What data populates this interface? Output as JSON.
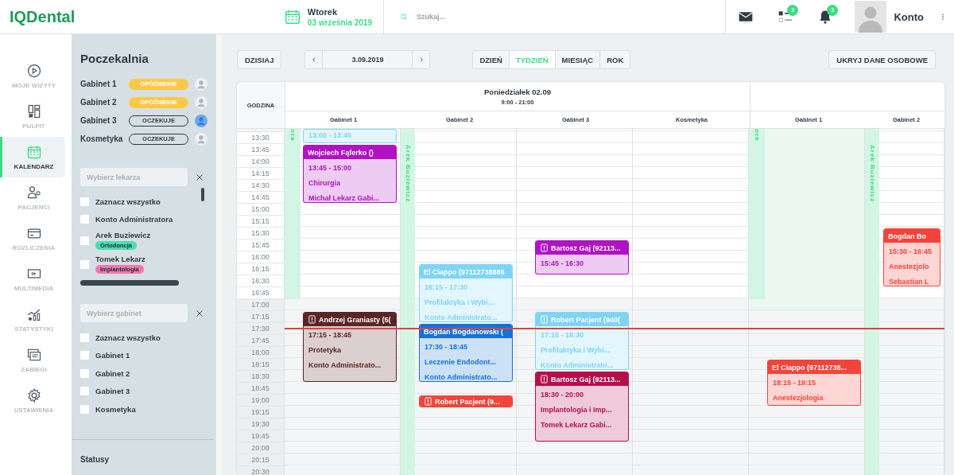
{
  "topbar": {
    "logo": "IQDental",
    "day": "Wtorek",
    "date": "03 września 2019",
    "search": {
      "placeholder": "Szukaj..."
    },
    "actions": [
      {
        "kind": "mail"
      },
      {
        "kind": "tasks",
        "badge": "2"
      },
      {
        "kind": "bell",
        "badge": "2"
      }
    ],
    "account": "Konto"
  },
  "nav": [
    {
      "label": "MOJE WIZYTY",
      "kind": "play",
      "selected": false
    },
    {
      "label": "PULPIT",
      "kind": "dashboard",
      "selected": false
    },
    {
      "label": "KALENDARZ",
      "kind": "calendar",
      "selected": true
    },
    {
      "label": "PACJENCI",
      "kind": "users",
      "selected": false
    },
    {
      "label": "ROZLICZENIA",
      "kind": "card",
      "selected": false
    },
    {
      "label": "MULTIMEDIA",
      "kind": "video",
      "selected": false
    },
    {
      "label": "STATYSTYKI",
      "kind": "chart",
      "selected": false
    },
    {
      "label": "ZABIEGI",
      "kind": "layers",
      "selected": false
    },
    {
      "label": "USTAWIENIA",
      "kind": "gear",
      "selected": false
    }
  ],
  "waiting_room": {
    "title": "Poczekalnia",
    "rooms": [
      {
        "name": "Gabinet 1",
        "status": "OPÓŹNIENIE",
        "kind": "delay",
        "patient_present": false
      },
      {
        "name": "Gabinet 2",
        "status": "OPÓŹNIENIE",
        "kind": "delay",
        "patient_present": false
      },
      {
        "name": "Gabinet 3",
        "status": "OCZEKUJE",
        "kind": "waiting",
        "patient_present": true
      },
      {
        "name": "Kosmetyka",
        "status": "OCZEKUJE",
        "kind": "waiting",
        "patient_present": false
      }
    ]
  },
  "doctor_filter": {
    "placeholder": "Wybierz lekarza",
    "items": [
      {
        "label": "Zaznacz wszystko",
        "checked": false
      },
      {
        "label": "Konto Administratora",
        "checked": false
      },
      {
        "label": "Arek Buziewicz",
        "checked": false,
        "tag": {
          "text": "Ortodoncja",
          "color": "#4ddbb4"
        }
      },
      {
        "label": "Tomek Lekarz",
        "checked": false,
        "tag": {
          "text": "Implantologia",
          "color": "#f277b0"
        }
      }
    ]
  },
  "room_filter": {
    "placeholder": "Wybierz gabinet",
    "items": [
      {
        "label": "Zaznacz wszystko",
        "checked": false
      },
      {
        "label": "Gabinet 1",
        "checked": false
      },
      {
        "label": "Gabinet 2",
        "checked": false
      },
      {
        "label": "Gabinet 3",
        "checked": false
      },
      {
        "label": "Kosmetyka",
        "checked": false
      }
    ]
  },
  "statuses": {
    "title": "Statusy"
  },
  "toolbar": {
    "today": "DZISIAJ",
    "date": "3.09.2019",
    "views": [
      {
        "label": "DZIEŃ",
        "selected": false
      },
      {
        "label": "TYDZIEŃ",
        "selected": true
      },
      {
        "label": "MIESIĄC",
        "selected": false
      },
      {
        "label": "ROK",
        "selected": false
      }
    ],
    "hide_button": "UKRYJ DANE OSOBOWE"
  },
  "calendar": {
    "time_header": "GODZINA",
    "times": [
      {
        "label": "13:30",
        "open": true,
        "now": false
      },
      {
        "label": "13:45",
        "open": true,
        "now": false
      },
      {
        "label": "14:00",
        "open": true,
        "now": false
      },
      {
        "label": "14:15",
        "open": true,
        "now": false
      },
      {
        "label": "14:30",
        "open": true,
        "now": false
      },
      {
        "label": "14:45",
        "open": true,
        "now": false
      },
      {
        "label": "15:00",
        "open": true,
        "now": false
      },
      {
        "label": "15:15",
        "open": true,
        "now": false
      },
      {
        "label": "15:30",
        "open": true,
        "now": false
      },
      {
        "label": "15:45",
        "open": true,
        "now": false
      },
      {
        "label": "16:00",
        "open": true,
        "now": false
      },
      {
        "label": "16:15",
        "open": true,
        "now": false
      },
      {
        "label": "16:30",
        "open": true,
        "now": false
      },
      {
        "label": "16:45",
        "open": true,
        "now": false
      },
      {
        "label": "17:00",
        "open": false,
        "now": false
      },
      {
        "label": "17:15",
        "open": false,
        "now": false
      },
      {
        "label": "17:30",
        "open": false,
        "now": true
      },
      {
        "label": "17:45",
        "open": false,
        "now": false
      },
      {
        "label": "18:00",
        "open": false,
        "now": false
      },
      {
        "label": "18:15",
        "open": false,
        "now": false
      },
      {
        "label": "18:30",
        "open": false,
        "now": false
      },
      {
        "label": "18:45",
        "open": false,
        "now": false
      },
      {
        "label": "19:00",
        "open": false,
        "now": false
      },
      {
        "label": "19:15",
        "open": false,
        "now": false
      },
      {
        "label": "19:30",
        "open": false,
        "now": false
      },
      {
        "label": "19:45",
        "open": false,
        "now": false
      },
      {
        "label": "20:00",
        "open": false,
        "now": false
      },
      {
        "label": "20:15",
        "open": false,
        "now": false
      },
      {
        "label": "20:30",
        "open": false,
        "now": false
      }
    ],
    "days": [
      {
        "title": "Poniedziałek 02.09",
        "hours": "9:00 - 21:00",
        "rooms": [
          {
            "name": "Gabinet 1",
            "strip": {
              "doctor": "ora",
              "level": 0.49
            },
            "events": [
              {
                "color": "#7fd4f6",
                "time": "13:00 - 13:45"
              },
              {
                "color": "#b012c4",
                "title": "Wojciech Fąferko ()",
                "time": "13:45 - 15:00",
                "lines": [
                  "Chirurgia",
                  "Michał Lekarz Gabi..."
                ]
              },
              {
                "color": "#5b2526",
                "alert": true,
                "title": "Andrzej Graniasty (5(",
                "time": "17:15 - 18:45",
                "lines": [
                  "Protetyka",
                  "Konto Administrato..."
                ]
              }
            ]
          },
          {
            "name": "Gabinet 2",
            "strip": {
              "doctor": "Arek Buziewicz",
              "level": 1
            },
            "events": [
              {
                "color": "#7fd4f6",
                "title": "El Ciappo (97112738886",
                "time": "16:15 - 17:30",
                "lines": [
                  "Profilaktyka i Wybi...",
                  "Konto Administrato..."
                ]
              },
              {
                "color": "#1572d8",
                "title": "Bogdan Bogdanowski (",
                "time": "17:30 - 18:45",
                "lines": [
                  "Leczenie Endodont...",
                  "Konto Administrato..."
                ]
              },
              {
                "color": "#f4433a",
                "alert": true,
                "title": "Robert Pacjent (9..."
              }
            ]
          },
          {
            "name": "Gabinet 3",
            "events": [
              {
                "color": "#b012c4",
                "alert": true,
                "title": "Bartosz Gaj (92113...",
                "time": "15:45 - 16:30"
              },
              {
                "color": "#7fd4f6",
                "alert": true,
                "title": "Robert Pacjent (940(",
                "time": "17:15 - 18:30",
                "lines": [
                  "Profilaktyka i Wybi...",
                  "Konto Administrato..."
                ]
              },
              {
                "color": "#b5104c",
                "alert": true,
                "title": "Bartosz Gaj (92113...",
                "time": "18:30 - 20:00",
                "lines": [
                  "Implantologia i Imp...",
                  "Tomek Lekarz Gabi..."
                ]
              }
            ]
          },
          {
            "name": "Kosmetyka"
          }
        ]
      },
      {
        "rooms": [
          {
            "name": "Gabinet 1",
            "strip": {
              "doctor": "ora",
              "level": 0.49
            },
            "shade": {
              "level": 0.52
            },
            "events": [
              {
                "color": "#f4433a",
                "title": "El Ciappo (97112738...",
                "time": "18:15 - 19:15",
                "lines": [
                  "Anestezjologia"
                ]
              }
            ]
          },
          {
            "name": "Gabinet 2",
            "strip": {
              "doctor": "Arek Buziewicz",
              "level": 1
            },
            "events": [
              {
                "color": "#f4433a",
                "title": "Bogdan Bo",
                "time": "15:30 - 16:45",
                "lines": [
                  "Anestezjolo",
                  "Sebastian L"
                ]
              }
            ]
          }
        ]
      }
    ]
  }
}
